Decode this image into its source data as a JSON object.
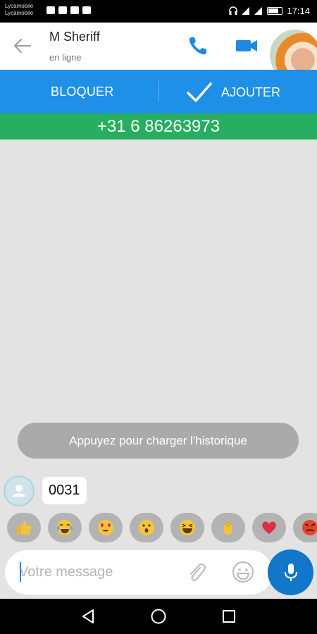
{
  "status_bar": {
    "carrier_1": "Lycamobile",
    "carrier_2": "Lycamobile",
    "time": "17:14"
  },
  "header": {
    "contact_name": "M Sheriff",
    "contact_status": "en ligne"
  },
  "actions": {
    "block_label": "BLOQUER",
    "add_label": "AJOUTER"
  },
  "phone_number": "+31 6 86263973",
  "history_label": "Appuyez pour charger l'historique",
  "messages": [
    {
      "text": "0031"
    }
  ],
  "reactions": [
    "thumbs-up",
    "tears-of-joy",
    "heart-eyes",
    "surprised",
    "grinning",
    "clapping",
    "heart",
    "angry"
  ],
  "input": {
    "placeholder": "Votre message",
    "value": ""
  },
  "colors": {
    "action_bar": "#1e90e8",
    "number_bar": "#27ae60",
    "accent": "#1276c9",
    "background": "#e3e3e3"
  }
}
